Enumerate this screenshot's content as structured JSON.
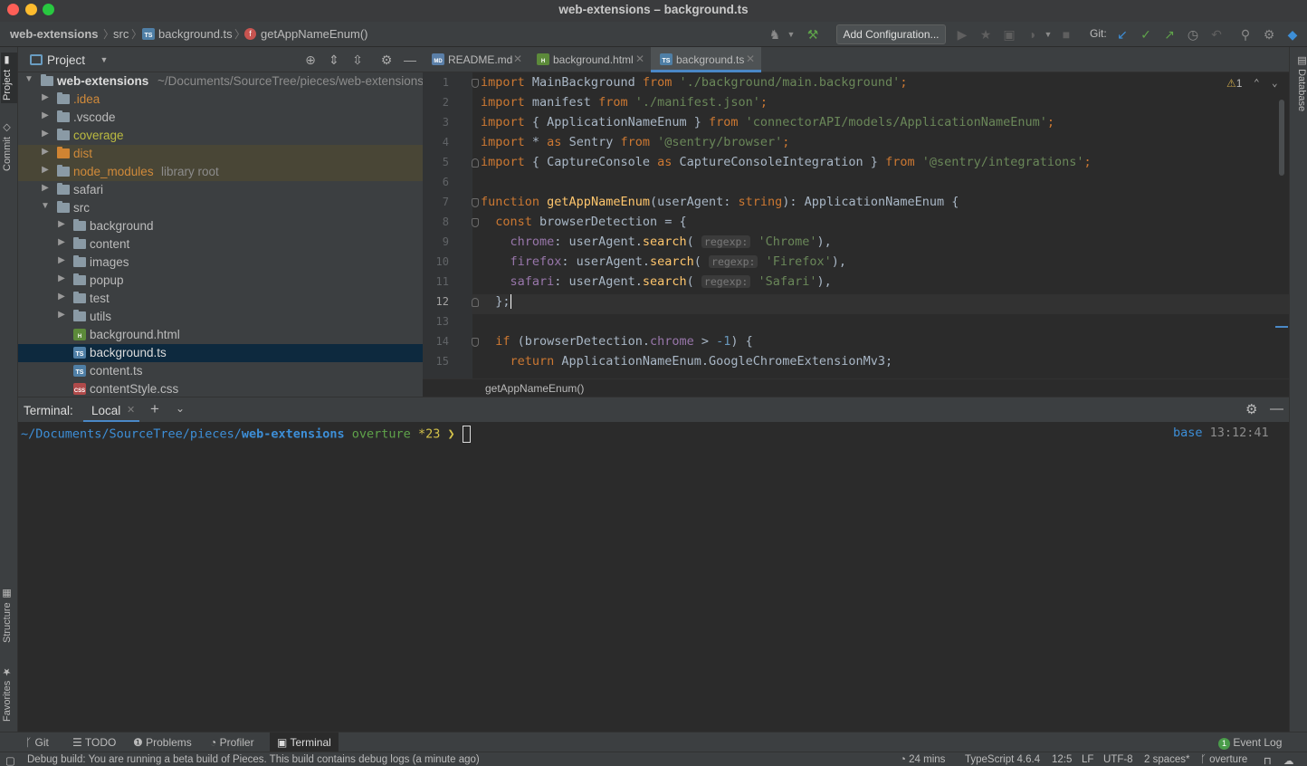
{
  "window": {
    "title": "web-extensions – background.ts"
  },
  "navbar": {
    "crumbs": [
      "web-extensions",
      "src",
      "background.ts",
      "getAppNameEnum()"
    ],
    "add_configuration": "Add Configuration...",
    "git_label": "Git:"
  },
  "left_strip": {
    "project": "Project",
    "commit": "Commit",
    "structure": "Structure",
    "favorites": "Favorites"
  },
  "right_strip": {
    "database": "Database"
  },
  "project_panel": {
    "title": "Project",
    "root_name": "web-extensions",
    "root_path": "~/Documents/SourceTree/pieces/web-extensions",
    "items": [
      {
        "label": ".idea",
        "kind": "folder"
      },
      {
        "label": ".vscode",
        "kind": "folder"
      },
      {
        "label": "coverage",
        "kind": "folder"
      },
      {
        "label": "dist",
        "kind": "folder"
      },
      {
        "label": "node_modules",
        "note": "library root",
        "kind": "folder"
      },
      {
        "label": "safari",
        "kind": "folder"
      },
      {
        "label": "src",
        "kind": "folder"
      },
      {
        "label": "background",
        "kind": "folder"
      },
      {
        "label": "content",
        "kind": "folder"
      },
      {
        "label": "images",
        "kind": "folder"
      },
      {
        "label": "popup",
        "kind": "folder"
      },
      {
        "label": "test",
        "kind": "folder"
      },
      {
        "label": "utils",
        "kind": "folder"
      },
      {
        "label": "background.html",
        "kind": "html"
      },
      {
        "label": "background.ts",
        "kind": "ts"
      },
      {
        "label": "content.ts",
        "kind": "ts"
      },
      {
        "label": "contentStyle.css",
        "kind": "css"
      }
    ]
  },
  "editor": {
    "tabs": [
      {
        "label": "README.md",
        "icon": "md-file-icon"
      },
      {
        "label": "background.html",
        "icon": "html-file-icon"
      },
      {
        "label": "background.ts",
        "icon": "ts-file-icon",
        "active": true
      }
    ],
    "line_numbers": [
      "1",
      "2",
      "3",
      "4",
      "5",
      "6",
      "7",
      "8",
      "9",
      "10",
      "11",
      "12",
      "13",
      "14",
      "15"
    ],
    "current_line": "12",
    "warnings_count": "1",
    "hint_regexp": "regexp:",
    "breadcrumb": "getAppNameEnum()",
    "code": {
      "import": "import",
      "from": "from",
      "as": "as",
      "function": "function",
      "const": "const",
      "if": "if",
      "return": "return",
      "l1_id": " MainBackground ",
      "l1_str": "'./background/main.background'",
      "l2_id": " manifest ",
      "l2_str": "'./manifest.json'",
      "l3_id": " { ApplicationNameEnum } ",
      "l3_str": "'connectorAPI/models/ApplicationNameEnum'",
      "l4_star": " * ",
      "l4_id": " Sentry ",
      "l4_str": "'@sentry/browser'",
      "l5_open": " { CaptureConsole ",
      "l5_id": " CaptureConsoleIntegration } ",
      "l5_str": "'@sentry/integrations'",
      "semi": ";",
      "l7_name": "getAppNameEnum",
      "l7_param": "(userAgent: ",
      "l7_type": "string",
      "l7_rest": "): ApplicationNameEnum {",
      "l8_rest": " browserDetection = {",
      "l9_prop": "chrome",
      "l9_str": "'Chrome'",
      "l10_prop": "firefox",
      "l10_str": "'Firefox'",
      "l11_prop": "safari",
      "l11_str": "'Safari'",
      "ua": ": userAgent.",
      "search": "search",
      "paren_open": "( ",
      "close_comma": "),",
      "l12": "};",
      "l14_a": " (browserDetection.",
      "l14_prop": "chrome",
      "l14_b": " > ",
      "l14_num": "-1",
      "l14_c": ") {",
      "l15_rest": " ApplicationNameEnum.GoogleChromeExtensionMv3;"
    }
  },
  "terminal": {
    "label": "Terminal:",
    "tab": "Local",
    "prompt_path": "~/Documents/SourceTree/pieces/",
    "prompt_dir": "web-extensions",
    "prompt_branch": "overture",
    "prompt_status": "*23",
    "prompt_arrow": "❯",
    "right_env": "base",
    "right_time": "13:12:41"
  },
  "bottom_toolbar": {
    "git": "Git",
    "todo": "TODO",
    "problems": "Problems",
    "profiler": "Profiler",
    "terminal": "Terminal",
    "event_log": "Event Log",
    "event_log_count": "1"
  },
  "statusbar": {
    "message": "Debug build: You are running a beta build of Pieces. This build contains debug logs (a minute ago)",
    "time": "24 mins",
    "language": "TypeScript 4.6.4",
    "position": "12:5",
    "line_sep": "LF",
    "encoding": "UTF-8",
    "indent": "2 spaces*",
    "branch": "overture"
  },
  "colors": {
    "accent": "#4a88c7",
    "selection": "#0d293e",
    "keyword": "#cc7832",
    "string": "#6a8759"
  }
}
